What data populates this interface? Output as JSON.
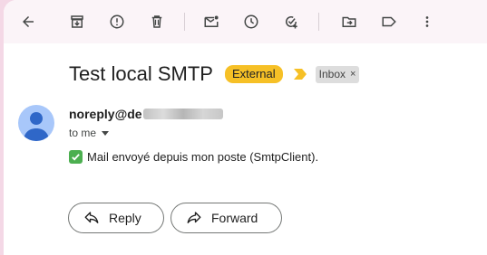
{
  "toolbar": {
    "icons": [
      "back-arrow-icon",
      "archive-icon",
      "report-spam-icon",
      "delete-icon",
      "mark-unread-icon",
      "snooze-icon",
      "add-to-tasks-icon",
      "move-to-icon",
      "label-icon",
      "more-vert-icon"
    ]
  },
  "email": {
    "subject": "Test local SMTP",
    "external_badge": "External",
    "inbox_label": "Inbox",
    "inbox_remove": "×",
    "sender": "noreply@de",
    "to": "to me",
    "body": "Mail envoyé depuis mon poste (SmtpClient).",
    "check_glyph": "✓"
  },
  "actions": {
    "reply": "Reply",
    "forward": "Forward"
  },
  "colors": {
    "page_bg": "#f4d8e6",
    "external_badge": "#f6c026",
    "importance_marker": "#f6c026",
    "avatar_bg": "#a8c7fa",
    "avatar_fg": "#2f67c8",
    "check_bg": "#4caf50"
  }
}
